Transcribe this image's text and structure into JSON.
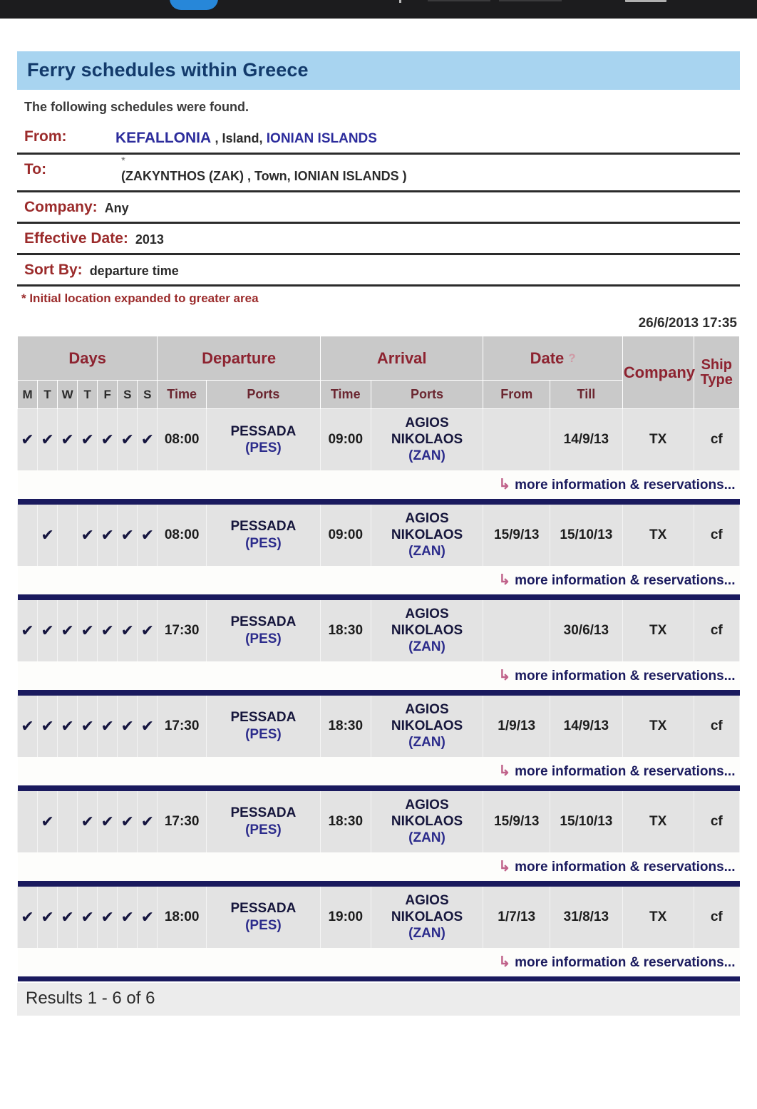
{
  "browser_chrome": {
    "visible": true,
    "note": "cropped dark browser toolbar strip"
  },
  "header": {
    "title": "Ferry schedules within Greece",
    "title_bg": "#a8d4f0",
    "title_color": "#123a6b",
    "subtitle": "The following schedules were found."
  },
  "criteria": {
    "from_label": "From:",
    "from_city": "KEFALLONIA",
    "from_mid": ", Island,",
    "from_region": "IONIAN ISLANDS",
    "to_label": "To:",
    "to_star": "*",
    "to_value": "(ZAKYNTHOS (ZAK) , Town, IONIAN ISLANDS )",
    "company_label": "Company:",
    "company_value": "Any",
    "effective_label": "Effective Date:",
    "effective_value": "2013",
    "sort_label": "Sort By:",
    "sort_value": "departure time",
    "footnote": "* Initial location expanded to greater area"
  },
  "timestamp": "26/6/2013 17:35",
  "table": {
    "group_headers": {
      "days": "Days",
      "departure": "Departure",
      "arrival": "Arrival",
      "date": "Date",
      "date_help_icon": "question-mark-icon",
      "company": "Company",
      "ship_type_line1": "Ship",
      "ship_type_line2": "Type"
    },
    "sub_headers": {
      "days": [
        "M",
        "T",
        "W",
        "T",
        "F",
        "S",
        "S"
      ],
      "dep_time": "Time",
      "dep_ports": "Ports",
      "arr_time": "Time",
      "arr_ports": "Ports",
      "date_from": "From",
      "date_till": "Till"
    },
    "check_glyph": "✔",
    "more_link_label": "more information & reservations...",
    "more_link_arrow": "↳",
    "rows": [
      {
        "days": [
          true,
          true,
          true,
          true,
          true,
          true,
          true
        ],
        "dep_time": "08:00",
        "dep_port_name": "PESSADA",
        "dep_port_code": "(PES)",
        "arr_time": "09:00",
        "arr_port_name": "AGIOS NIKOLAOS",
        "arr_port_name_l1": "AGIOS",
        "arr_port_name_l2": "NIKOLAOS",
        "arr_port_code": "(ZAN)",
        "date_from": "",
        "date_till": "14/9/13",
        "company": "TX",
        "ship_type": "cf"
      },
      {
        "days": [
          false,
          true,
          false,
          true,
          true,
          true,
          true
        ],
        "dep_time": "08:00",
        "dep_port_name": "PESSADA",
        "dep_port_code": "(PES)",
        "arr_time": "09:00",
        "arr_port_name": "AGIOS NIKOLAOS",
        "arr_port_name_l1": "AGIOS",
        "arr_port_name_l2": "NIKOLAOS",
        "arr_port_code": "(ZAN)",
        "date_from": "15/9/13",
        "date_till": "15/10/13",
        "company": "TX",
        "ship_type": "cf"
      },
      {
        "days": [
          true,
          true,
          true,
          true,
          true,
          true,
          true
        ],
        "dep_time": "17:30",
        "dep_port_name": "PESSADA",
        "dep_port_code": "(PES)",
        "arr_time": "18:30",
        "arr_port_name": "AGIOS NIKOLAOS",
        "arr_port_name_l1": "AGIOS",
        "arr_port_name_l2": "NIKOLAOS",
        "arr_port_code": "(ZAN)",
        "date_from": "",
        "date_till": "30/6/13",
        "company": "TX",
        "ship_type": "cf"
      },
      {
        "days": [
          true,
          true,
          true,
          true,
          true,
          true,
          true
        ],
        "dep_time": "17:30",
        "dep_port_name": "PESSADA",
        "dep_port_code": "(PES)",
        "arr_time": "18:30",
        "arr_port_name": "AGIOS NIKOLAOS",
        "arr_port_name_l1": "AGIOS",
        "arr_port_name_l2": "NIKOLAOS",
        "arr_port_code": "(ZAN)",
        "date_from": "1/9/13",
        "date_till": "14/9/13",
        "company": "TX",
        "ship_type": "cf"
      },
      {
        "days": [
          false,
          true,
          false,
          true,
          true,
          true,
          true
        ],
        "dep_time": "17:30",
        "dep_port_name": "PESSADA",
        "dep_port_code": "(PES)",
        "arr_time": "18:30",
        "arr_port_name": "AGIOS NIKOLAOS",
        "arr_port_name_l1": "AGIOS",
        "arr_port_name_l2": "NIKOLAOS",
        "arr_port_code": "(ZAN)",
        "date_from": "15/9/13",
        "date_till": "15/10/13",
        "company": "TX",
        "ship_type": "cf"
      },
      {
        "days": [
          true,
          true,
          true,
          true,
          true,
          true,
          true
        ],
        "dep_time": "18:00",
        "dep_port_name": "PESSADA",
        "dep_port_code": "(PES)",
        "arr_time": "19:00",
        "arr_port_name": "AGIOS NIKOLAOS",
        "arr_port_name_l1": "AGIOS",
        "arr_port_name_l2": "NIKOLAOS",
        "arr_port_code": "(ZAN)",
        "date_from": "1/7/13",
        "date_till": "31/8/13",
        "company": "TX",
        "ship_type": "cf"
      }
    ]
  },
  "footer": {
    "results_text": "Results 1 - 6 of 6"
  }
}
